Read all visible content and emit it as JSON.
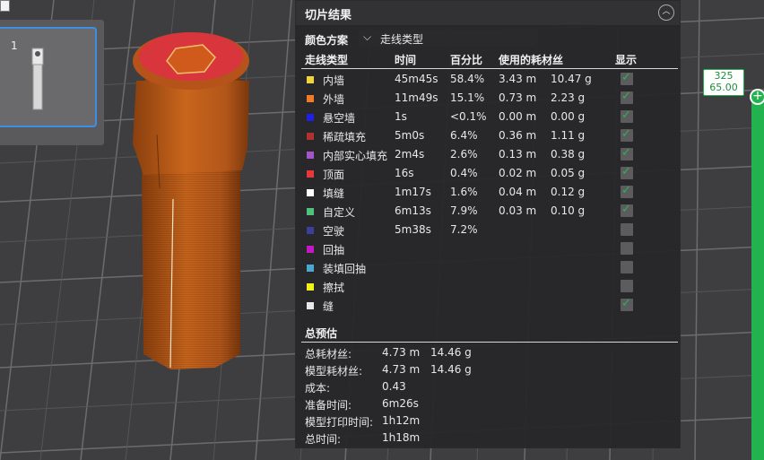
{
  "thumbnail": {
    "plate_number": "1"
  },
  "panel": {
    "title": "切片结果",
    "scheme_label": "颜色方案",
    "scheme_value": "走线类型",
    "headers": [
      "走线类型",
      "时间",
      "百分比",
      "使用的耗材丝",
      "显示"
    ],
    "rows": [
      {
        "name": "内墙",
        "time": "45m45s",
        "pct": "58.4%",
        "len": "3.43 m",
        "weight": "10.47 g",
        "color": "#f2d33a",
        "visible": true
      },
      {
        "name": "外墙",
        "time": "11m49s",
        "pct": "15.1%",
        "len": "0.73 m",
        "weight": "2.23 g",
        "color": "#f07c2a",
        "visible": true
      },
      {
        "name": "悬空墙",
        "time": "1s",
        "pct": "<0.1%",
        "len": "0.00 m",
        "weight": "0.00 g",
        "color": "#1f1fe6",
        "visible": true
      },
      {
        "name": "稀疏填充",
        "time": "5m0s",
        "pct": "6.4%",
        "len": "0.36 m",
        "weight": "1.11 g",
        "color": "#b0322e",
        "visible": true
      },
      {
        "name": "内部实心填充",
        "time": "2m4s",
        "pct": "2.6%",
        "len": "0.13 m",
        "weight": "0.38 g",
        "color": "#a456c8",
        "visible": true
      },
      {
        "name": "顶面",
        "time": "16s",
        "pct": "0.4%",
        "len": "0.02 m",
        "weight": "0.05 g",
        "color": "#e6383a",
        "visible": true
      },
      {
        "name": "填缝",
        "time": "1m17s",
        "pct": "1.6%",
        "len": "0.04 m",
        "weight": "0.12 g",
        "color": "#ffffff",
        "visible": true
      },
      {
        "name": "自定义",
        "time": "6m13s",
        "pct": "7.9%",
        "len": "0.03 m",
        "weight": "0.10 g",
        "color": "#4ec27a",
        "visible": true
      },
      {
        "name": "空驶",
        "time": "5m38s",
        "pct": "7.2%",
        "len": "",
        "weight": "",
        "color": "#3b3f9a",
        "visible": false
      },
      {
        "name": "回抽",
        "time": "",
        "pct": "",
        "len": "",
        "weight": "",
        "color": "#c418c4",
        "visible": false
      },
      {
        "name": "装填回抽",
        "time": "",
        "pct": "",
        "len": "",
        "weight": "",
        "color": "#48a8d0",
        "visible": false
      },
      {
        "name": "擦拭",
        "time": "",
        "pct": "",
        "len": "",
        "weight": "",
        "color": "#f2f21a",
        "visible": false
      },
      {
        "name": "缝",
        "time": "",
        "pct": "",
        "len": "",
        "weight": "",
        "color": "#e8e8e8",
        "visible": true
      }
    ],
    "summary_title": "总预估",
    "summary": [
      {
        "label": "总耗材丝:",
        "v1": "4.73 m",
        "v2": "14.46 g"
      },
      {
        "label": "模型耗材丝:",
        "v1": "4.73 m",
        "v2": "14.46 g"
      },
      {
        "label": "成本:",
        "v1": "0.43",
        "v2": ""
      },
      {
        "label": "准备时间:",
        "v1": "6m26s",
        "v2": ""
      },
      {
        "label": "模型打印时间:",
        "v1": "1h12m",
        "v2": ""
      },
      {
        "label": "总时间:",
        "v1": "1h18m",
        "v2": ""
      }
    ]
  },
  "layer_slider": {
    "layer": "325",
    "height": "65.00",
    "color": "#22b34e"
  },
  "model_color": "#c8621a"
}
